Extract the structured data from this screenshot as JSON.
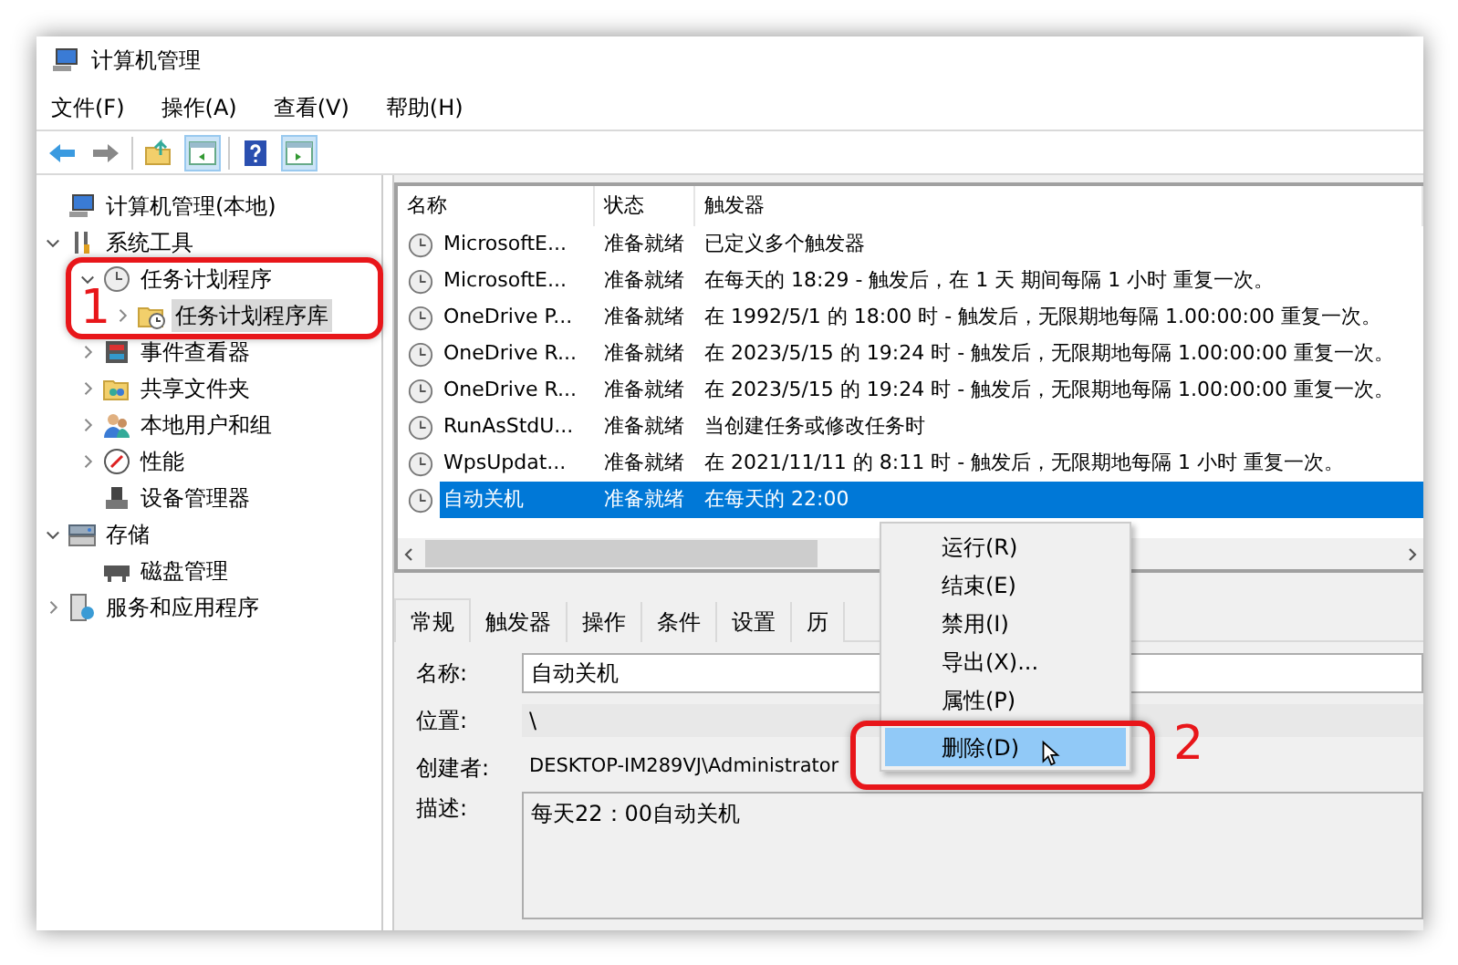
{
  "window": {
    "title": "计算机管理"
  },
  "menu": [
    "文件(F)",
    "操作(A)",
    "查看(V)",
    "帮助(H)"
  ],
  "tree": [
    {
      "label": "计算机管理(本地)",
      "kind": "computer",
      "selected": false,
      "children": [
        {
          "label": "系统工具",
          "kind": "tools",
          "expanded": true,
          "selected": false,
          "children": [
            {
              "label": "任务计划程序",
              "kind": "clock",
              "expanded": true,
              "selected": false,
              "children": [
                {
                  "label": "任务计划程序库",
                  "kind": "folder-clock",
                  "expanded": false,
                  "selected": true
                }
              ]
            },
            {
              "label": "事件查看器",
              "kind": "event",
              "expanded": false,
              "selected": false
            },
            {
              "label": "共享文件夹",
              "kind": "share",
              "expanded": false,
              "selected": false
            },
            {
              "label": "本地用户和组",
              "kind": "users",
              "expanded": false,
              "selected": false
            },
            {
              "label": "性能",
              "kind": "perf",
              "expanded": false,
              "selected": false
            },
            {
              "label": "设备管理器",
              "kind": "device",
              "selected": false
            }
          ]
        },
        {
          "label": "存储",
          "kind": "storage",
          "expanded": true,
          "selected": false,
          "children": [
            {
              "label": "磁盘管理",
              "kind": "disk",
              "selected": false
            }
          ]
        },
        {
          "label": "服务和应用程序",
          "kind": "services",
          "expanded": false,
          "selected": false
        }
      ]
    }
  ],
  "tasks": {
    "columns": [
      "名称",
      "状态",
      "触发器"
    ],
    "rows": [
      {
        "name": "MicrosoftE...",
        "status": "准备就绪",
        "trigger": "已定义多个触发器",
        "selected": false
      },
      {
        "name": "MicrosoftE...",
        "status": "准备就绪",
        "trigger": "在每天的 18:29 - 触发后，在 1 天 期间每隔 1 小时 重复一次。",
        "selected": false
      },
      {
        "name": "OneDrive P...",
        "status": "准备就绪",
        "trigger": "在 1992/5/1 的 18:00 时 - 触发后，无限期地每隔 1.00:00:00 重复一次。",
        "selected": false
      },
      {
        "name": "OneDrive R...",
        "status": "准备就绪",
        "trigger": "在 2023/5/15 的 19:24 时 - 触发后，无限期地每隔 1.00:00:00 重复一次。",
        "selected": false
      },
      {
        "name": "OneDrive R...",
        "status": "准备就绪",
        "trigger": "在 2023/5/15 的 19:24 时 - 触发后，无限期地每隔 1.00:00:00 重复一次。",
        "selected": false
      },
      {
        "name": "RunAsStdU...",
        "status": "准备就绪",
        "trigger": "当创建任务或修改任务时",
        "selected": false
      },
      {
        "name": "WpsUpdat...",
        "status": "准备就绪",
        "trigger": "在 2021/11/11 的 8:11 时 - 触发后，无限期地每隔 1 小时 重复一次。",
        "selected": false
      },
      {
        "name": "自动关机",
        "status": "准备就绪",
        "trigger": "在每天的 22:00",
        "selected": true
      }
    ]
  },
  "tabs": [
    {
      "label": "常规",
      "selected": true
    },
    {
      "label": "触发器",
      "selected": false
    },
    {
      "label": "操作",
      "selected": false
    },
    {
      "label": "条件",
      "selected": false
    },
    {
      "label": "设置",
      "selected": false
    },
    {
      "label": "历",
      "selected": false
    }
  ],
  "fields": [
    {
      "label": "名称:",
      "value": "自动关机",
      "kind": "input"
    },
    {
      "label": "位置:",
      "value": "\\",
      "kind": "text"
    },
    {
      "label": "创建者:",
      "value": "DESKTOP-IM289VJ\\Administrator",
      "kind": "plain"
    },
    {
      "label": "描述:",
      "value": "每天22：00自动关机",
      "kind": "textarea"
    }
  ],
  "context_menu": [
    {
      "label": "运行(R)",
      "selected": false
    },
    {
      "label": "结束(E)",
      "selected": false
    },
    {
      "label": "禁用(I)",
      "selected": false
    },
    {
      "label": "导出(X)...",
      "selected": false
    },
    {
      "label": "属性(P)",
      "selected": false
    },
    {
      "label": "删除(D)",
      "selected": true
    }
  ],
  "annotations": [
    {
      "label": "1"
    },
    {
      "label": "2"
    }
  ]
}
